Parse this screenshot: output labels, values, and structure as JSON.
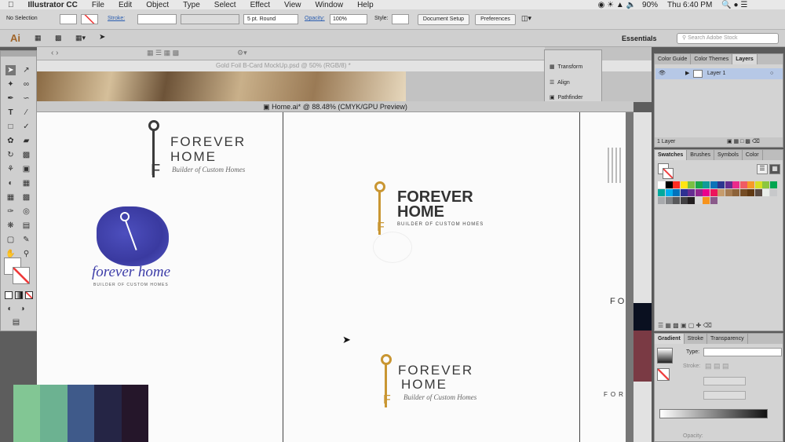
{
  "menubar": {
    "app": "Illustrator CC",
    "items": [
      "File",
      "Edit",
      "Object",
      "Type",
      "Select",
      "Effect",
      "View",
      "Window",
      "Help"
    ],
    "battery": "90%",
    "clock": "Thu 6:40 PM"
  },
  "control": {
    "selection": "No Selection",
    "stroke_label": "Stroke:",
    "brush": "5 pt. Round",
    "opacity_label": "Opacity:",
    "opacity": "100%",
    "style_label": "Style:",
    "doc_setup": "Document Setup",
    "preferences": "Preferences"
  },
  "appbar": {
    "logo": "Ai",
    "workspace": "Essentials",
    "search_placeholder": "Search Adobe Stock"
  },
  "background_doc": {
    "title": "Gold Foil B-Card MockUp.psd @ 50% (RGB/8) *"
  },
  "document": {
    "title": "Home.ai* @ 88.48% (CMYK/GPU Preview)"
  },
  "float_panel": {
    "items": [
      "Transform",
      "Align",
      "Pathfinder"
    ]
  },
  "layers_panel": {
    "tabs": [
      "Color Guide",
      "Color Themes",
      "Layers"
    ],
    "layer_name": "Layer 1",
    "count": "1 Layer"
  },
  "swatches_panel": {
    "tabs": [
      "Swatches",
      "Brushes",
      "Symbols",
      "Color"
    ]
  },
  "gradient_panel": {
    "tabs": [
      "Gradient",
      "Stroke",
      "Transparency"
    ],
    "type_label": "Type:",
    "stroke_label": "Stroke:",
    "opacity_label": "Opacity:"
  },
  "logo1": {
    "line1": "FOREVER",
    "line2": "HOME",
    "tag": "Builder of Custom Homes",
    "f": "F"
  },
  "logo2": {
    "script": "forever home",
    "tag": "BUILDER OF CUSTOM HOMES"
  },
  "logo3": {
    "line1": "FOREVER",
    "line2": "HOME",
    "tag": "BUILDER OF CUSTOM HOMES",
    "f": "F"
  },
  "logo4": {
    "line1": "FOREVER",
    "line2": "HOME",
    "tag": "Builder of Custom Homes",
    "f": "F"
  },
  "partial": {
    "fo": "FO",
    "for": "FOR"
  },
  "palette": {
    "colors": [
      "#82c694",
      "#6cb291",
      "#3f5a8a",
      "#252545",
      "#25162a"
    ]
  },
  "swatch_colors": [
    "#ffffff",
    "#000000",
    "#ff2d21",
    "#ffe512",
    "#7ac043",
    "#1aa74b",
    "#109b99",
    "#0a73b8",
    "#2d3690",
    "#652d90",
    "#ec2a8b",
    "#f05b64",
    "#f69a29",
    "#d7df23",
    "#8cc63f",
    "#00a651",
    "#00a99d",
    "#00aeef",
    "#0072bc",
    "#2e3192",
    "#662d91",
    "#92278f",
    "#ec008c",
    "#ed145b",
    "#c69c6d",
    "#a67c52",
    "#8c6239",
    "#754c24",
    "#603913",
    "#594a42",
    "#e9ede9",
    "#c7c8ca",
    "#a7a9ac",
    "#808285",
    "#58595b",
    "#414042",
    "#231f20",
    "#d9d9d9",
    "#f7941d",
    "#8a5a8a"
  ]
}
